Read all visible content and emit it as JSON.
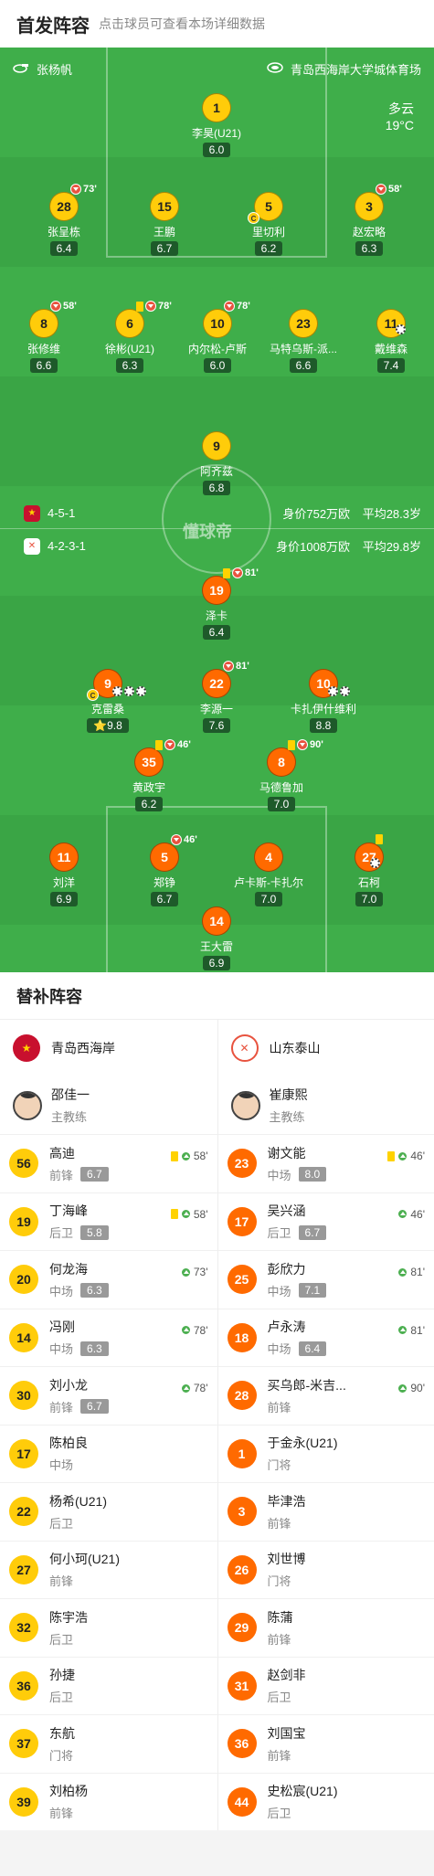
{
  "header": {
    "title": "首发阵容",
    "subtitle": "点击球员可查看本场详细数据"
  },
  "pitch": {
    "referee": "张杨帆",
    "stadium": "青岛西海岸大学城体育场",
    "weather": "多云",
    "temperature": "19°C",
    "watermark": "懂球帝",
    "home": {
      "formation": "4-5-1",
      "value": "身价752万欧",
      "avg_age": "平均28.3岁"
    },
    "away": {
      "formation": "4-2-3-1",
      "value": "身价1008万欧",
      "avg_age": "平均29.8岁"
    }
  },
  "home_players": [
    {
      "num": "1",
      "name": "李昊(U21)",
      "rating": "6.0"
    },
    {
      "num": "28",
      "name": "张呈栋",
      "rating": "6.4",
      "sub": "73'"
    },
    {
      "num": "15",
      "name": "王鹏",
      "rating": "6.7"
    },
    {
      "num": "5",
      "name": "里切利",
      "rating": "6.2",
      "captain": "C"
    },
    {
      "num": "3",
      "name": "赵宏略",
      "rating": "6.3",
      "sub": "58'"
    },
    {
      "num": "8",
      "name": "张修维",
      "rating": "6.6",
      "sub": "58'"
    },
    {
      "num": "6",
      "name": "徐彬(U21)",
      "rating": "6.3",
      "sub": "78'"
    },
    {
      "num": "10",
      "name": "内尔松-卢斯",
      "rating": "6.0",
      "sub": "78'"
    },
    {
      "num": "23",
      "name": "马特乌斯-派...",
      "rating": "6.6"
    },
    {
      "num": "11",
      "name": "戴维森",
      "rating": "7.4"
    },
    {
      "num": "9",
      "name": "阿齐兹",
      "rating": "6.8"
    }
  ],
  "away_players": [
    {
      "num": "19",
      "name": "泽卡",
      "rating": "6.4",
      "sub": "81'"
    },
    {
      "num": "9",
      "name": "克雷桑",
      "rating": "9.8",
      "captain": "C"
    },
    {
      "num": "22",
      "name": "李源一",
      "rating": "7.6",
      "sub": "81'"
    },
    {
      "num": "10",
      "name": "卡扎伊什维利",
      "rating": "8.8"
    },
    {
      "num": "35",
      "name": "黄政宇",
      "rating": "6.2",
      "sub": "46'"
    },
    {
      "num": "8",
      "name": "马德鲁加",
      "rating": "7.0",
      "sub": "90'"
    },
    {
      "num": "11",
      "name": "刘洋",
      "rating": "6.9"
    },
    {
      "num": "5",
      "name": "郑铮",
      "rating": "6.7",
      "sub": "46'"
    },
    {
      "num": "4",
      "name": "卢卡斯-卡扎尔",
      "rating": "7.0"
    },
    {
      "num": "27",
      "name": "石柯",
      "rating": "7.0"
    },
    {
      "num": "14",
      "name": "王大雷",
      "rating": "6.9"
    }
  ],
  "subs": {
    "title": "替补阵容",
    "home": {
      "team": "青岛西海岸",
      "coach": {
        "name": "邵佳一",
        "role": "主教练"
      },
      "players": [
        {
          "num": "56",
          "name": "高迪",
          "pos": "前锋",
          "rating": "6.7",
          "in": "58'"
        },
        {
          "num": "19",
          "name": "丁海峰",
          "pos": "后卫",
          "rating": "5.8",
          "in": "58'"
        },
        {
          "num": "20",
          "name": "何龙海",
          "pos": "中场",
          "rating": "6.3",
          "in": "73'"
        },
        {
          "num": "14",
          "name": "冯刚",
          "pos": "中场",
          "rating": "6.3",
          "in": "78'"
        },
        {
          "num": "30",
          "name": "刘小龙",
          "pos": "前锋",
          "rating": "6.7",
          "in": "78'"
        },
        {
          "num": "17",
          "name": "陈柏良",
          "pos": "中场"
        },
        {
          "num": "22",
          "name": "杨希(U21)",
          "pos": "后卫"
        },
        {
          "num": "27",
          "name": "何小珂(U21)",
          "pos": "前锋"
        },
        {
          "num": "32",
          "name": "陈宇浩",
          "pos": "后卫"
        },
        {
          "num": "36",
          "name": "孙捷",
          "pos": "后卫"
        },
        {
          "num": "37",
          "name": "东航",
          "pos": "门将"
        },
        {
          "num": "39",
          "name": "刘柏杨",
          "pos": "前锋"
        }
      ]
    },
    "away": {
      "team": "山东泰山",
      "coach": {
        "name": "崔康熙",
        "role": "主教练"
      },
      "players": [
        {
          "num": "23",
          "name": "谢文能",
          "pos": "中场",
          "rating": "8.0",
          "in": "46'"
        },
        {
          "num": "17",
          "name": "吴兴涵",
          "pos": "后卫",
          "rating": "6.7",
          "in": "46'"
        },
        {
          "num": "25",
          "name": "彭欣力",
          "pos": "中场",
          "rating": "7.1",
          "in": "81'"
        },
        {
          "num": "18",
          "name": "卢永涛",
          "pos": "中场",
          "rating": "6.4",
          "in": "81'"
        },
        {
          "num": "28",
          "name": "买乌郎-米吉...",
          "pos": "前锋",
          "in": "90'"
        },
        {
          "num": "1",
          "name": "于金永(U21)",
          "pos": "门将"
        },
        {
          "num": "3",
          "name": "毕津浩",
          "pos": "前锋"
        },
        {
          "num": "26",
          "name": "刘世博",
          "pos": "门将"
        },
        {
          "num": "29",
          "name": "陈蒲",
          "pos": "前锋"
        },
        {
          "num": "31",
          "name": "赵剑非",
          "pos": "后卫"
        },
        {
          "num": "36",
          "name": "刘国宝",
          "pos": "前锋"
        },
        {
          "num": "44",
          "name": "史松宸(U21)",
          "pos": "后卫"
        }
      ]
    }
  }
}
